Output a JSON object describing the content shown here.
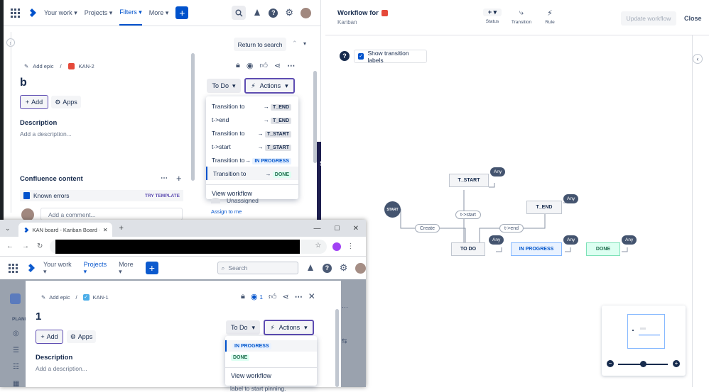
{
  "jira_bg": {
    "nav": {
      "your_work": "Your work",
      "projects": "Projects",
      "filters": "Filters",
      "more": "More"
    },
    "return_to_search": "Return to search",
    "breadcrumb": {
      "add_epic": "Add epic",
      "sep": "/",
      "issue_key": "KAN-2"
    },
    "issue_title": "b",
    "add_label": "Add",
    "apps_label": "Apps",
    "description_heading": "Description",
    "description_placeholder": "Add a description...",
    "confluence_heading": "Confluence content",
    "known_errors": "Known errors",
    "try_template": "TRY TEMPLATE",
    "add_comment": "Add a comment...",
    "status_button": "To Do",
    "actions_button": "Actions",
    "menu": [
      {
        "label": "Transition to",
        "target": "T_END"
      },
      {
        "label": "t->end",
        "target": "T_END"
      },
      {
        "label": "Transition to",
        "target": "T_START"
      },
      {
        "label": "t->start",
        "target": "T_START"
      },
      {
        "label": "Transition to",
        "target": "IN PROGRESS"
      },
      {
        "label": "Transition to",
        "target": "DONE"
      }
    ],
    "view_workflow": "View workflow",
    "unassigned": "Unassigned",
    "assign_to_me": "Assign to me",
    "partial_text": "s"
  },
  "workflow": {
    "title": "Workflow for",
    "subtitle": "Kanban",
    "status_label": "Status",
    "transition_label": "Transition",
    "rule_label": "Rule",
    "update_btn": "Update workflow",
    "close_btn": "Close",
    "show_labels": "Show transition labels",
    "nodes": {
      "start": "START",
      "t_start": "T_START",
      "t_end": "T_END",
      "todo": "TO DO",
      "inprogress": "IN PROGRESS",
      "done": "DONE"
    },
    "any": "Any",
    "pills": {
      "create": "Create",
      "t_start": "t->start",
      "t_end": "t->end"
    }
  },
  "browser": {
    "tab_title": "KAN board - Kanban Board - Ji",
    "nav": {
      "your_work": "Your work",
      "projects": "Projects",
      "more": "More",
      "search": "Search"
    },
    "plan_label": "PLANI",
    "breadcrumb": {
      "add_epic": "Add epic",
      "sep": "/",
      "issue_key": "KAN-1"
    },
    "watch_count": "1",
    "issue_title": "1",
    "add_label": "Add",
    "apps_label": "Apps",
    "description_heading": "Description",
    "description_placeholder": "Add a description...",
    "status_button": "To Do",
    "actions_button": "Actions",
    "menu": [
      {
        "label": "IN PROGRESS"
      },
      {
        "label": "DONE"
      }
    ],
    "view_workflow": "View workflow",
    "pin_hint": "label to start pinning."
  },
  "colors": {
    "brand": "#0052cc",
    "inprogress_bg": "#e9f2ff",
    "done_bg": "#dcfff1",
    "done_text": "#216e4e",
    "purple": "#5e4db2"
  }
}
